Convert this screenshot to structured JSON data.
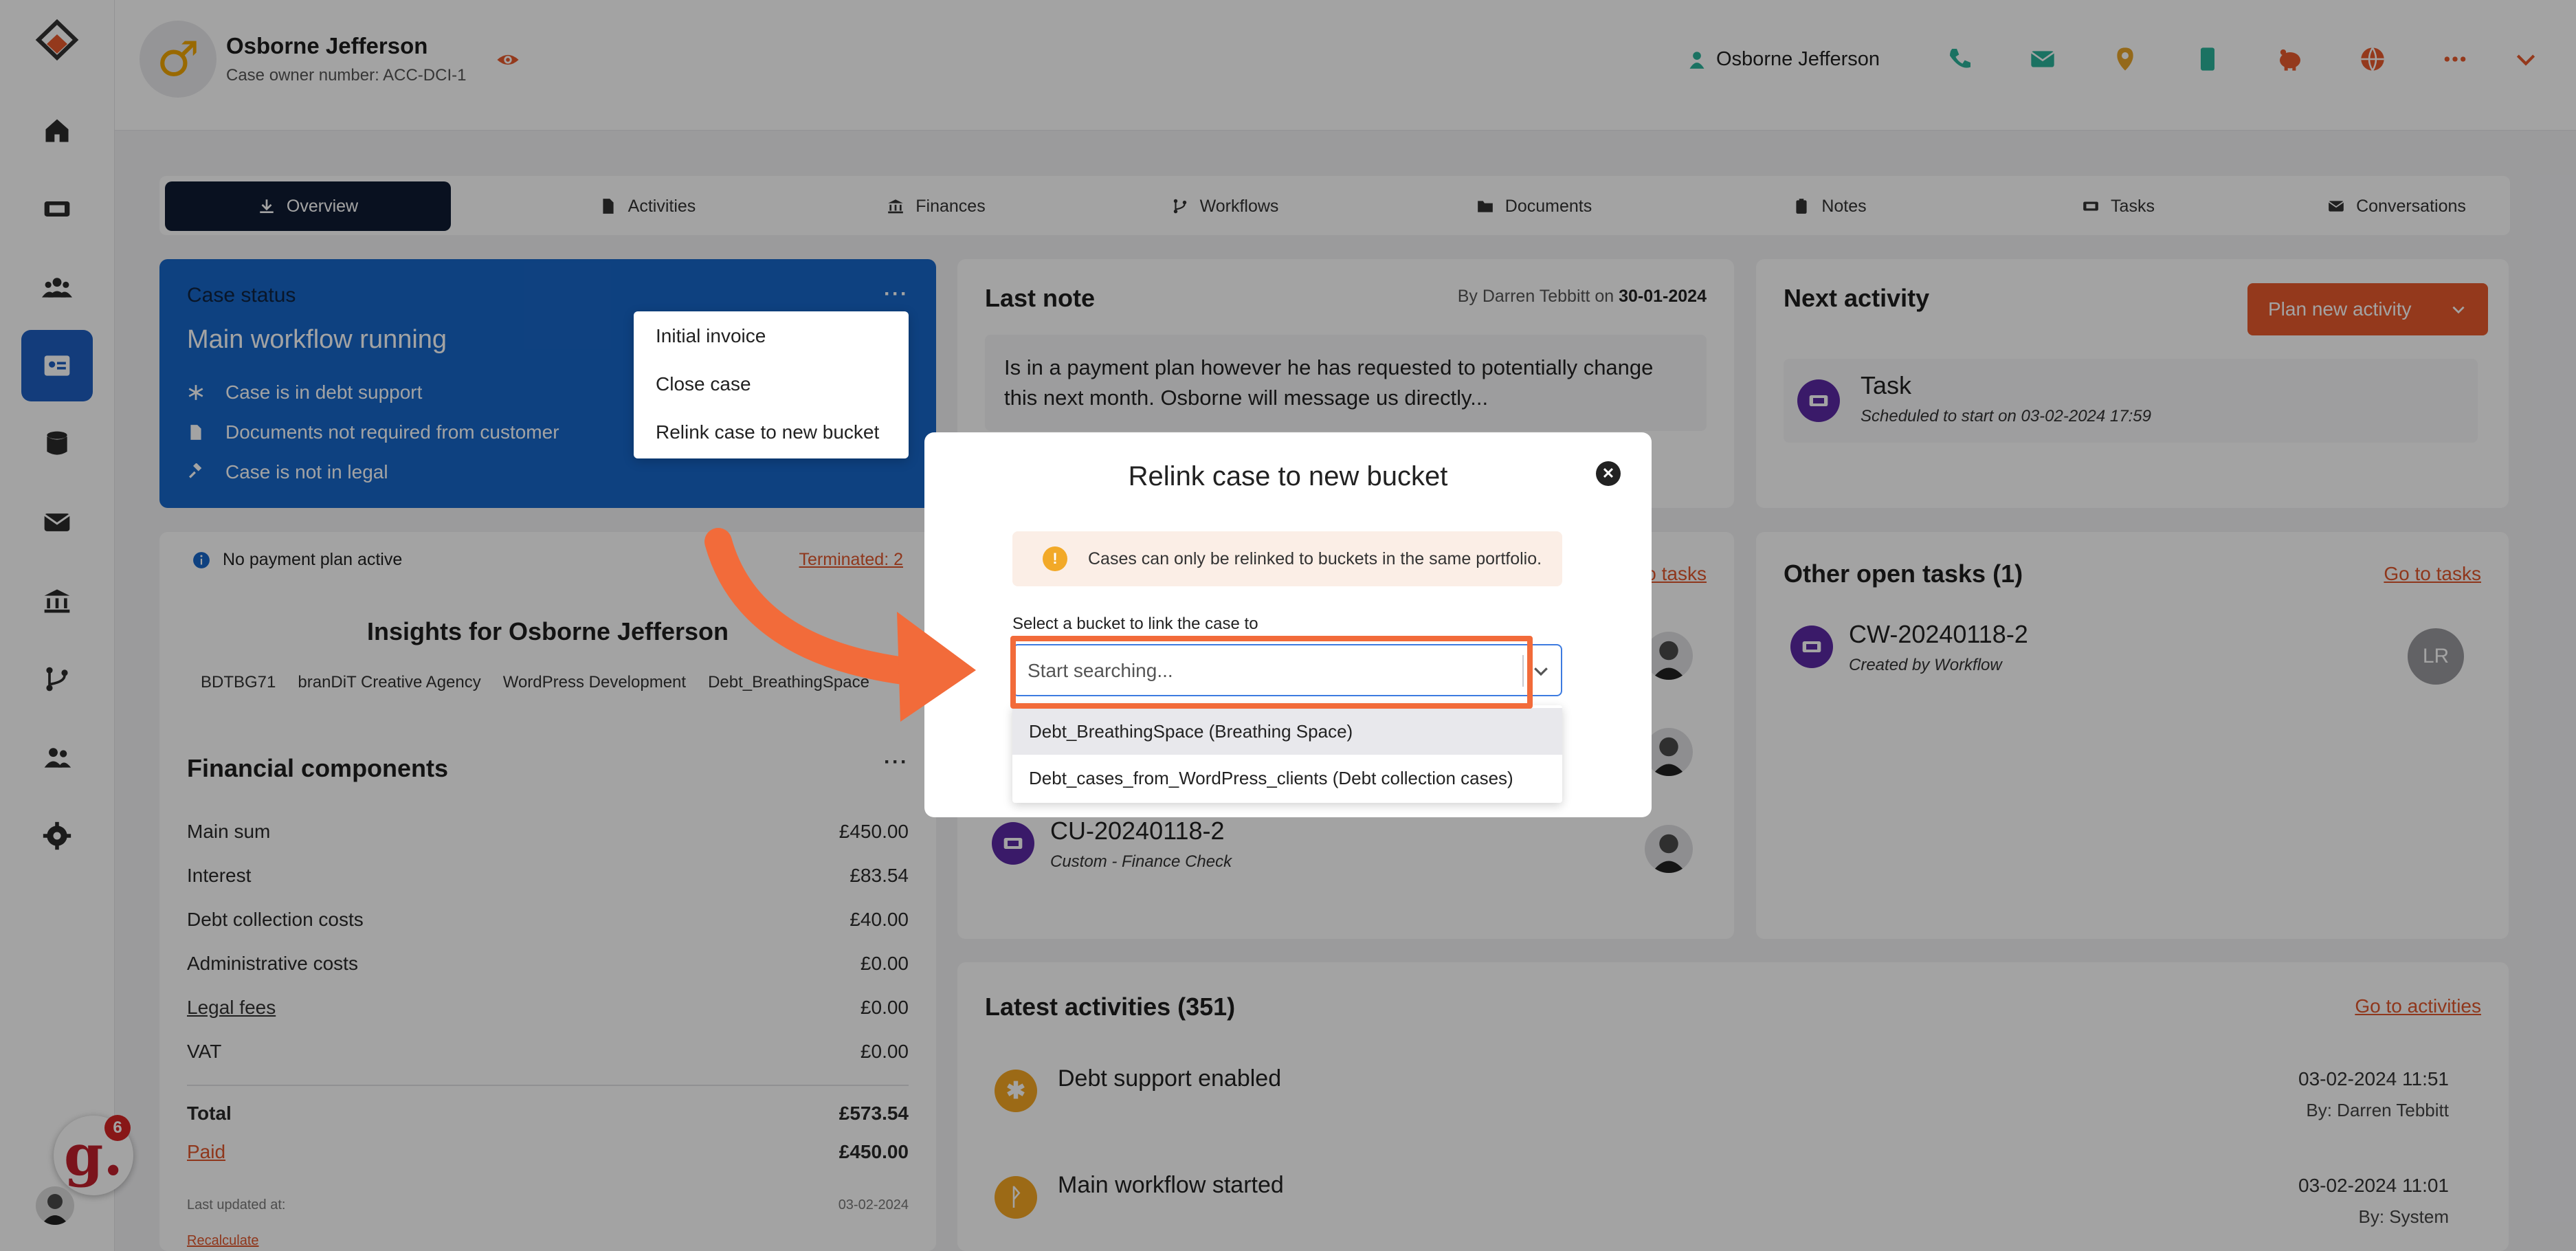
{
  "header": {
    "name": "Osborne Jefferson",
    "case_owner": "Case owner number: ACC-DCI-1",
    "user_name": "Osborne Jefferson"
  },
  "sidebar": {
    "items": [
      "home-icon",
      "ticket-icon",
      "users-icon",
      "contact-card-icon",
      "database-icon",
      "mail-icon",
      "bank-icon",
      "workflow-icon",
      "team-icon",
      "settings-icon"
    ],
    "badge_letter": "g.",
    "badge_count": "6"
  },
  "tabs": [
    {
      "label": "Overview"
    },
    {
      "label": "Activities"
    },
    {
      "label": "Finances"
    },
    {
      "label": "Workflows"
    },
    {
      "label": "Documents"
    },
    {
      "label": "Notes"
    },
    {
      "label": "Tasks"
    },
    {
      "label": "Conversations"
    }
  ],
  "status": {
    "title": "Case status",
    "main": "Main workflow running",
    "rows": [
      "Case is in debt support",
      "Documents not required from customer",
      "Case is not in legal"
    ]
  },
  "menu": {
    "items": [
      "Initial invoice",
      "Close case",
      "Relink case to new bucket"
    ]
  },
  "payment": {
    "info": "No payment plan active",
    "terminated": "Terminated: 2"
  },
  "insights": {
    "title": "Insights for Osborne Jefferson",
    "tags": [
      "BDTBG71",
      "branDiT Creative Agency",
      "WordPress Development",
      "Debt_BreathingSpace"
    ]
  },
  "financial": {
    "title": "Financial components",
    "rows": [
      {
        "label": "Main sum",
        "value": "£450.00"
      },
      {
        "label": "Interest",
        "value": "£83.54"
      },
      {
        "label": "Debt collection costs",
        "value": "£40.00"
      },
      {
        "label": "Administrative costs",
        "value": "£0.00"
      },
      {
        "label": "Legal fees",
        "value": "£0.00"
      },
      {
        "label": "VAT",
        "value": "£0.00"
      }
    ],
    "total_label": "Total",
    "total_value": "£573.54",
    "paid_label": "Paid",
    "paid_value": "£450.00",
    "updated_label": "Last updated at:",
    "updated_value": "03-02-2024",
    "recalculate": "Recalculate"
  },
  "last_note": {
    "title": "Last note",
    "by_prefix": "By Darren Tebbitt on",
    "by_date": "30-01-2024",
    "text": "Is in a payment plan however he has requested to potentially change this next month. Osborne will message us directly..."
  },
  "next_activity": {
    "title": "Next activity",
    "plan_button": "Plan new activity",
    "task_title": "Task",
    "task_sub": "Scheduled to start on 03-02-2024 17:59"
  },
  "mid_tasks": {
    "link": "Go to tasks",
    "visible_task_title": "CU-20240118-2",
    "visible_task_sub": "Custom - Finance Check"
  },
  "other_tasks": {
    "title": "Other open tasks (1)",
    "link": "Go to tasks",
    "task_title": "CW-20240118-2",
    "task_sub": "Created by Workflow",
    "assignee": "LR"
  },
  "activities": {
    "title": "Latest activities (351)",
    "link": "Go to activities",
    "rows": [
      {
        "title": "Debt support enabled",
        "date": "03-02-2024 11:51",
        "by": "By: Darren Tebbitt"
      },
      {
        "title": "Main workflow started",
        "date": "03-02-2024 11:01",
        "by": "By: System"
      }
    ]
  },
  "modal": {
    "title": "Relink case to new bucket",
    "warning": "Cases can only be relinked to buckets in the same portfolio.",
    "field_label": "Select a bucket to link the case to",
    "placeholder": "Start searching...",
    "options": [
      "Debt_BreathingSpace (Breathing Space)",
      "Debt_cases_from_WordPress_clients (Debt collection cases)"
    ]
  },
  "colors": {
    "accent_blue": "#1766c8",
    "accent_orange": "#e85a2d",
    "dark_navy": "#0f1c33",
    "task_purple": "#5b2aa4"
  }
}
